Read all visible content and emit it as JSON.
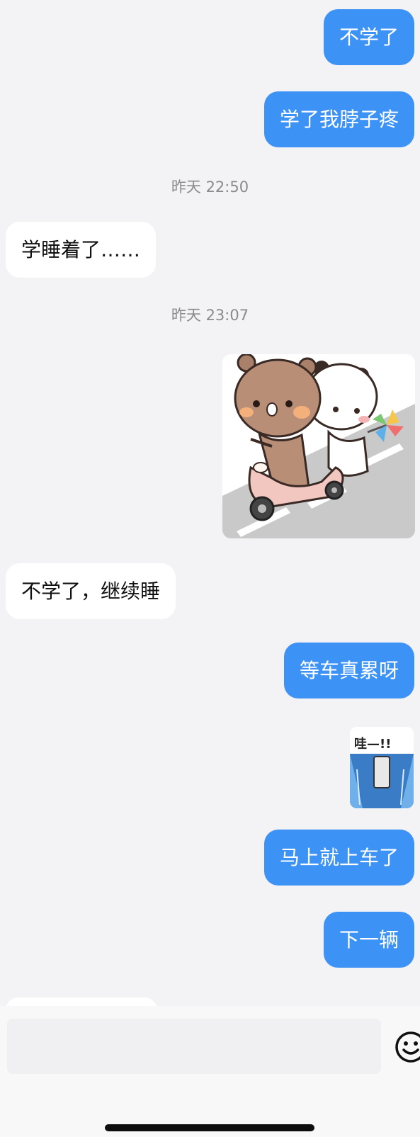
{
  "messages": [
    {
      "side": "out",
      "text": "不学了"
    },
    {
      "side": "out",
      "text": "学了我脖子疼"
    },
    {
      "time": "昨天 22:50"
    },
    {
      "side": "in",
      "text": "学睡着了……"
    },
    {
      "time": "昨天 23:07"
    },
    {
      "side": "out",
      "sticker": "bears-on-scooter-sticker"
    },
    {
      "side": "in",
      "text": "不学了，继续睡"
    },
    {
      "side": "out",
      "text": "等车真累呀"
    },
    {
      "side": "out",
      "sticker": "wa-umbrella-sticker",
      "sticker_text": "哇—!!"
    },
    {
      "side": "out",
      "text": "马上就上车了"
    },
    {
      "side": "out",
      "text": "下一辆"
    }
  ],
  "input": {
    "placeholder": "",
    "emoji_icon": "smiley-face-icon"
  },
  "colors": {
    "outgoing_bubble": "#3d93f5",
    "incoming_bubble": "#ffffff",
    "background": "#f3f3f5",
    "timestamp": "#8a8a8a"
  }
}
